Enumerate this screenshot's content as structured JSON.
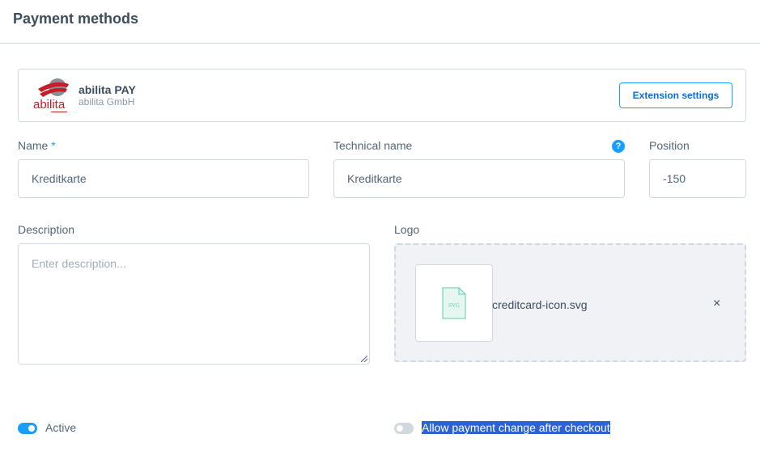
{
  "page": {
    "title": "Payment methods"
  },
  "extension": {
    "name": "abilita PAY",
    "vendor": "abilita GmbH",
    "logo_text": "abilita",
    "settings_label": "Extension settings"
  },
  "form": {
    "name": {
      "label": "Name",
      "required_mark": "*",
      "value": "Kreditkarte"
    },
    "technical_name": {
      "label": "Technical name",
      "value": "Kreditkarte",
      "help_glyph": "?"
    },
    "position": {
      "label": "Position",
      "value": "-150"
    },
    "description": {
      "label": "Description",
      "placeholder": "Enter description..."
    },
    "logo": {
      "label": "Logo",
      "filename": "creditcard-icon.svg",
      "file_badge": "SVG",
      "remove_glyph": "×"
    },
    "active": {
      "label": "Active",
      "checked": true
    },
    "allow_payment_change": {
      "label": "Allow payment change after checkout",
      "checked": false
    }
  },
  "colors": {
    "accent": "#189eff",
    "toggle_off": "#d1d9e0",
    "brand_red": "#c41e2a"
  }
}
